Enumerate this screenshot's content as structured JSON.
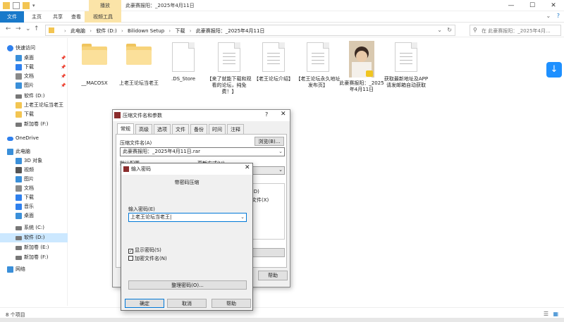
{
  "titlebar": {
    "title": "此豪赛报阳：_2025年4月11日",
    "context_tab": "播放",
    "minimize": "—",
    "maximize": "☐",
    "close": "✕"
  },
  "ribbon": {
    "tabs": [
      "文件",
      "主页",
      "共享",
      "查看",
      "视频工具"
    ],
    "collapse": "⌄",
    "help": "?"
  },
  "address": {
    "crumbs": [
      "此电脑",
      "软件 (D:)",
      "Bilidown Setup",
      "下载",
      "此豪赛报阳：_2025年4月11日"
    ],
    "search_placeholder": "在 此豪赛报阳：_2025年4月..."
  },
  "sidebar": {
    "items": [
      {
        "label": "快速访问",
        "color": "#2f80ed"
      },
      {
        "label": "桌面",
        "color": "#3a8fd9",
        "pin": "📌"
      },
      {
        "label": "下载",
        "color": "#2f80ed",
        "pin": "📌"
      },
      {
        "label": "文档",
        "color": "#8a8a8a",
        "pin": "📌"
      },
      {
        "label": "图片",
        "color": "#3a8fd9",
        "pin": "📌"
      },
      {
        "label": "软件 (D:)",
        "color": "#777777"
      },
      {
        "label": "上老王论坛当老王",
        "color": "#f3c552"
      },
      {
        "label": "下载",
        "color": "#f3c552"
      },
      {
        "label": "新加卷 (F:)",
        "color": "#777777"
      },
      {
        "label": "OneDrive",
        "color": "#2f80ed"
      },
      {
        "label": "此电脑",
        "color": "#3a8fd9"
      },
      {
        "label": "3D 对象",
        "color": "#3a8fd9"
      },
      {
        "label": "视频",
        "color": "#555555"
      },
      {
        "label": "图片",
        "color": "#3a8fd9"
      },
      {
        "label": "文档",
        "color": "#8a8a8a"
      },
      {
        "label": "下载",
        "color": "#2f80ed"
      },
      {
        "label": "音乐",
        "color": "#2f80ed"
      },
      {
        "label": "桌面",
        "color": "#3a8fd9"
      },
      {
        "label": "系统 (C:)",
        "color": "#777777"
      },
      {
        "label": "软件 (D:)",
        "color": "#777777"
      },
      {
        "label": "新加卷 (E:)",
        "color": "#777777"
      },
      {
        "label": "新加卷 (F:)",
        "color": "#777777"
      },
      {
        "label": "网络",
        "color": "#3a8fd9"
      }
    ]
  },
  "files": [
    {
      "name": "__MACOSX",
      "kind": "folder"
    },
    {
      "name": "上老王论坛当老王",
      "kind": "folder"
    },
    {
      "name": ".DS_Store",
      "kind": "doc"
    },
    {
      "name": "【来了就能下载和观看的论坛，纯免费！】",
      "kind": "doc"
    },
    {
      "name": "【老王论坛介绍】",
      "kind": "doc"
    },
    {
      "name": "【老王论坛永久地址发布页】",
      "kind": "doc"
    },
    {
      "name": "此豪赛报阳：_2025年4月11日",
      "kind": "thumb"
    },
    {
      "name": "获取最新地址及APP请发邮箱自动获取",
      "kind": "doc"
    }
  ],
  "status": {
    "count": "8 个项目"
  },
  "rar_dialog": {
    "title": "压缩文件名和参数",
    "help_q": "?",
    "close": "✕",
    "tabs": [
      "常规",
      "高级",
      "选项",
      "文件",
      "备份",
      "时间",
      "注释"
    ],
    "archive_label": "压缩文件名(A)",
    "browse": "浏览(B)...",
    "archive_name": "此豪赛报阳：_2025年4月11日.rar",
    "profile_label": "默认配置",
    "update_label": "更新方式(U)",
    "opt1": "(D)",
    "opt2": "文件(X)",
    "help": "帮助"
  },
  "pwd_dialog": {
    "title": "输入密码",
    "close": "✕",
    "heading": "带密码压缩",
    "label": "输入密码(E)",
    "value": "上老王论坛当老王|",
    "show_password": "显示密码(S)",
    "show_checked": "✓",
    "encrypt_names": "加密文件名(N)",
    "organize": "整理密码(O)...",
    "ok": "确定",
    "cancel": "取消",
    "help": "帮助"
  },
  "download_button": "↓"
}
